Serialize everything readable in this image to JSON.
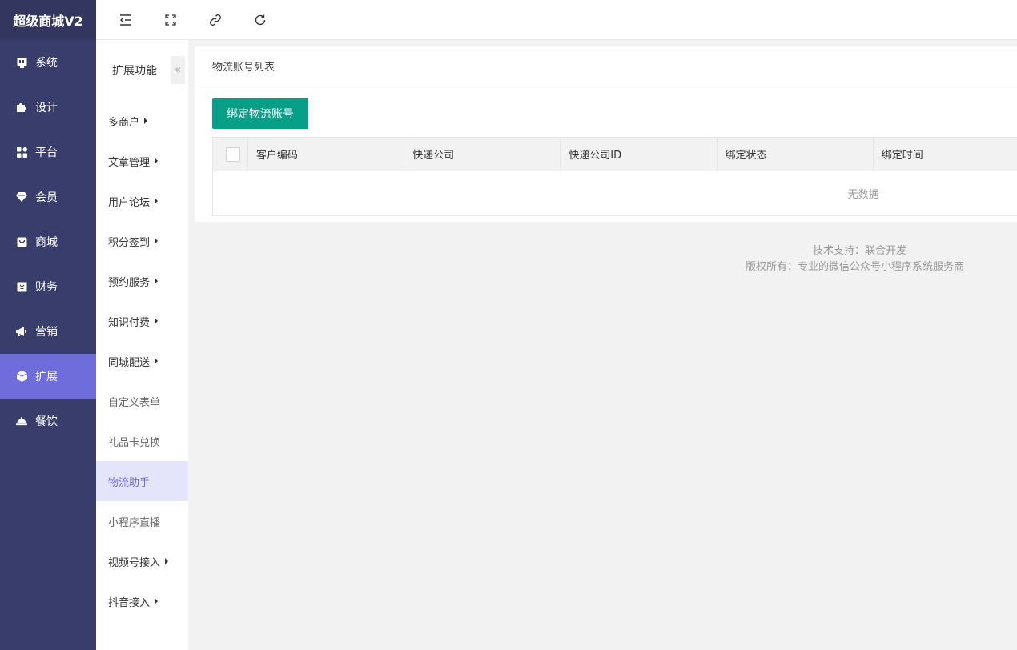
{
  "brand": {
    "title": "超级商城V2"
  },
  "main_nav": [
    {
      "label": "系统",
      "icon": "monitor-icon"
    },
    {
      "label": "设计",
      "icon": "puzzle-icon"
    },
    {
      "label": "平台",
      "icon": "grid-icon"
    },
    {
      "label": "会员",
      "icon": "diamond-icon"
    },
    {
      "label": "商城",
      "icon": "shopping-bag-icon"
    },
    {
      "label": "财务",
      "icon": "yen-icon"
    },
    {
      "label": "营销",
      "icon": "megaphone-icon"
    },
    {
      "label": "扩展",
      "icon": "cube-icon",
      "active": true
    },
    {
      "label": "餐饮",
      "icon": "cloche-icon"
    }
  ],
  "topbar": {
    "icons": [
      "menu-fold-icon",
      "fullscreen-icon",
      "link-icon",
      "refresh-icon"
    ]
  },
  "sub_menu": {
    "title": "扩展功能",
    "collapse_glyph": "«",
    "items": [
      {
        "label": "多商户",
        "has_arrow": true
      },
      {
        "label": "文章管理",
        "has_arrow": true
      },
      {
        "label": "用户论坛",
        "has_arrow": true
      },
      {
        "label": "积分签到",
        "has_arrow": true
      },
      {
        "label": "预约服务",
        "has_arrow": true
      },
      {
        "label": "知识付费",
        "has_arrow": true
      },
      {
        "label": "同城配送",
        "has_arrow": true
      },
      {
        "label": "自定义表单",
        "has_arrow": false
      },
      {
        "label": "礼品卡兑换",
        "has_arrow": false
      },
      {
        "label": "物流助手",
        "has_arrow": false,
        "active": true
      },
      {
        "label": "小程序直播",
        "has_arrow": false
      },
      {
        "label": "视频号接入",
        "has_arrow": true
      },
      {
        "label": "抖音接入",
        "has_arrow": true
      }
    ]
  },
  "content": {
    "header_title": "物流账号列表",
    "bind_button": "绑定物流账号",
    "table": {
      "columns": [
        "客户编码",
        "快递公司",
        "快递公司ID",
        "绑定状态",
        "绑定时间"
      ],
      "empty_text": "无数据"
    }
  },
  "footer": {
    "support": "技术支持：联合开发",
    "copyright": "版权所有：专业的微信公众号小程序系统服务商"
  },
  "colors": {
    "sidebar_bg": "#393d6b",
    "active_nav": "#6f6ddc",
    "primary": "#089f89",
    "sub_active_bg": "#e4e4fb"
  }
}
